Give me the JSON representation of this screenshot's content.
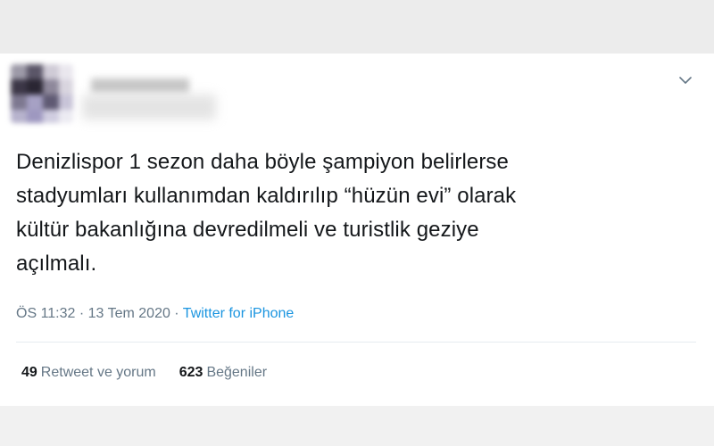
{
  "tweet": {
    "text": "Denizlispor 1 sezon daha böyle şampiyon belirlerse\nstadyumları kullanımdan kaldırılıp “hüzün evi” olarak\nkültür bakanlığına devredilmeli ve turistlik geziye\naçılmalı.",
    "time": "ÖS 11:32",
    "separator_1": " · ",
    "date": "13 Tem 2020",
    "separator_2": " · ",
    "source": "Twitter for iPhone"
  },
  "stats": {
    "retweets_count": "49",
    "retweets_label": "Retweet ve yorum",
    "likes_count": "623",
    "likes_label": "Beğeniler"
  },
  "icons": {
    "menu": "chevron-down-icon"
  },
  "colors": {
    "text": "#14171a",
    "secondary": "#657786",
    "link": "#1b95e0",
    "divider": "#e6ecf0"
  }
}
